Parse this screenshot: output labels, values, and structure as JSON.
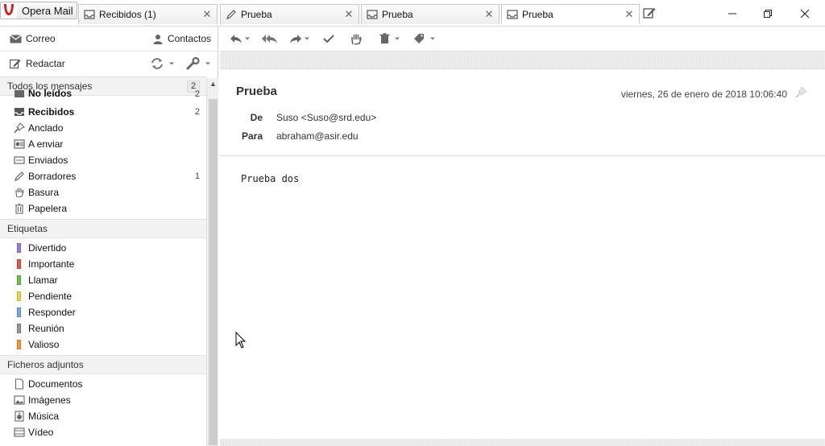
{
  "app": {
    "menu_label": "Opera Mail"
  },
  "tabs": [
    {
      "label": "Recibidos (1)",
      "icon": "inbox-icon",
      "close": "✕"
    },
    {
      "label": "Prueba",
      "icon": "pencil-icon",
      "close": "✕"
    },
    {
      "label": "Prueba",
      "icon": "inbox-icon",
      "close": "✕"
    },
    {
      "label": "Prueba",
      "icon": "inbox-icon",
      "close": "✕"
    }
  ],
  "sidebar": {
    "mail_label": "Correo",
    "contacts_label": "Contactos",
    "compose_label": "Redactar",
    "all_messages": {
      "label": "Todos los mensajes",
      "count": "2"
    },
    "mail_items": [
      {
        "label": "No leídos",
        "count": "2",
        "bold": true
      },
      {
        "label": "Recibidos",
        "count": "2",
        "bold": true
      },
      {
        "label": "Anclado",
        "count": ""
      },
      {
        "label": "A enviar",
        "count": ""
      },
      {
        "label": "Enviados",
        "count": ""
      },
      {
        "label": "Borradores",
        "count": "1"
      },
      {
        "label": "Basura",
        "count": ""
      },
      {
        "label": "Papelera",
        "count": ""
      }
    ],
    "labels_head": "Etiquetas",
    "labels": [
      {
        "label": "Divertido",
        "color": "#9b7fd4"
      },
      {
        "label": "Importante",
        "color": "#e05a4a"
      },
      {
        "label": "Llamar",
        "color": "#6cc24a"
      },
      {
        "label": "Pendiente",
        "color": "#e8d84a"
      },
      {
        "label": "Responder",
        "color": "#7aa8e0"
      },
      {
        "label": "Reunión",
        "color": "#999999"
      },
      {
        "label": "Valioso",
        "color": "#f29a3a"
      }
    ],
    "attachments_head": "Ficheros adjuntos",
    "attachments": [
      {
        "label": "Documentos"
      },
      {
        "label": "Imágenes"
      },
      {
        "label": "Música"
      },
      {
        "label": "Vídeo"
      }
    ]
  },
  "message": {
    "subject": "Prueba",
    "date": "viernes, 26 de enero de 2018 10:06:40",
    "from_label": "De",
    "from_value": "Suso <Suso@srd.edu>",
    "to_label": "Para",
    "to_value": "abraham@asir.edu",
    "body": "Prueba dos"
  }
}
